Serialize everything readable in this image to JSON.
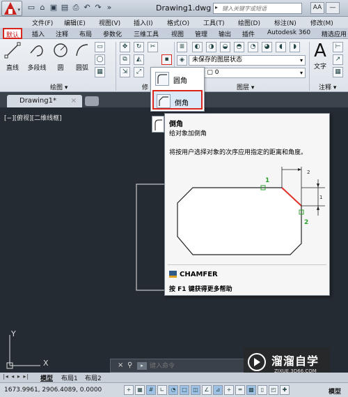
{
  "titlebar": {
    "document": "Drawing1.dwg",
    "search_placeholder": "键入关键字或短语",
    "right_buttons": [
      "AA",
      "—",
      "×"
    ]
  },
  "menubar": [
    "文件(F)",
    "编辑(E)",
    "视图(V)",
    "插入(I)",
    "格式(O)",
    "工具(T)",
    "绘图(D)",
    "标注(N)",
    "修改(M)"
  ],
  "ribbon_tabs": [
    "默认",
    "插入",
    "注释",
    "布局",
    "参数化",
    "三维工具",
    "视图",
    "管理",
    "输出",
    "插件",
    "Autodesk 360",
    "精选应用"
  ],
  "ribbon": {
    "draw_tools": [
      "直线",
      "多段线",
      "圆",
      "圆弧"
    ],
    "draw_panel": "绘图 ▾",
    "modify_panel": "修",
    "layer_state": "未保存的图层状态",
    "layer_current": "0",
    "layer_panel": "图层 ▾",
    "text_tool": "文字",
    "annot_panel": "注释 ▾"
  },
  "doc_tab": {
    "name": "Drawing1*",
    "close": "×"
  },
  "viewport_label": "[−][俯视][二维线框]",
  "flyout": {
    "items": [
      "圆角",
      "倒角"
    ],
    "selected": "倒角"
  },
  "tooltip": {
    "title": "倒角",
    "desc": "给对象加倒角",
    "long_desc": "将按用户选择对象的次序应用指定的距离和角度。",
    "figure_labels": [
      "1",
      "2",
      "2",
      "1"
    ],
    "command": "CHAMFER",
    "help": "按 F1 键获得更多帮助"
  },
  "ucs": {
    "x": "X",
    "y": "Y"
  },
  "command_line": {
    "placeholder": "键入命令"
  },
  "watermark": {
    "name": "溜溜自学",
    "url": "ZIXUE.3D66.COM"
  },
  "layout_tabs": [
    "模型",
    "布局1",
    "布局2"
  ],
  "statusbar": {
    "coords": "1673.9961, 2906.4089, 0.0000",
    "space": "模型"
  },
  "colors": {
    "accent_red": "#d9261c",
    "canvas": "#252b32",
    "green": "#2ca02c"
  }
}
